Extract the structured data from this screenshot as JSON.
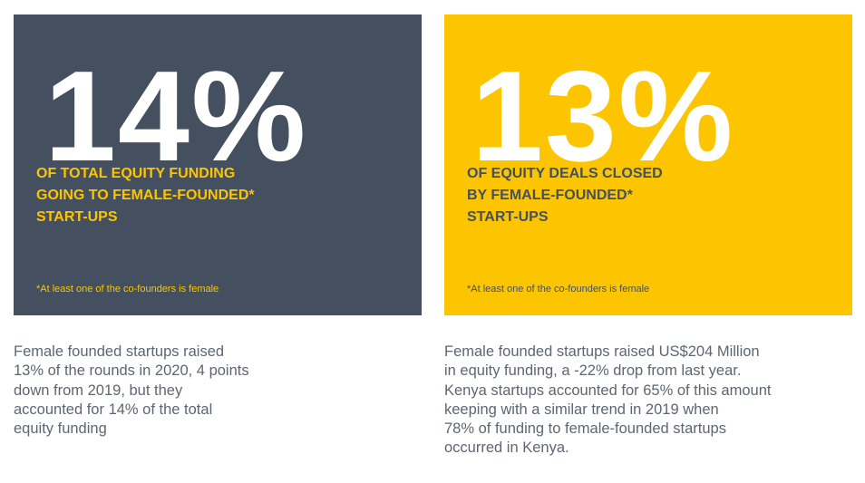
{
  "left_card": {
    "stat": "14%",
    "headline": [
      "OF TOTAL EQUITY FUNDING",
      "GOING TO FEMALE-FOUNDED*",
      "START-UPS"
    ],
    "footnote": "*At least one of the co-founders is female",
    "background_color": "#44505f",
    "accent_color": "#fdc500"
  },
  "right_card": {
    "stat": "13%",
    "headline": [
      "OF EQUITY DEALS CLOSED",
      "BY FEMALE-FOUNDED*",
      "START-UPS"
    ],
    "footnote": "*At least one of the co-founders is female",
    "background_color": "#fdc500",
    "accent_color": "#44505f"
  },
  "left_description": [
    "Female founded startups raised",
    "13% of the rounds in 2020, 4 points",
    "down from 2019, but they",
    "accounted for 14% of the total",
    "equity funding"
  ],
  "right_description": [
    "Female founded startups raised US$204 Million",
    "in equity funding, a -22% drop from last year.",
    "Kenya startups accounted for 65% of this amount",
    "keeping with a similar trend in 2019 when",
    "78% of funding to female-founded startups",
    "occurred in Kenya."
  ]
}
